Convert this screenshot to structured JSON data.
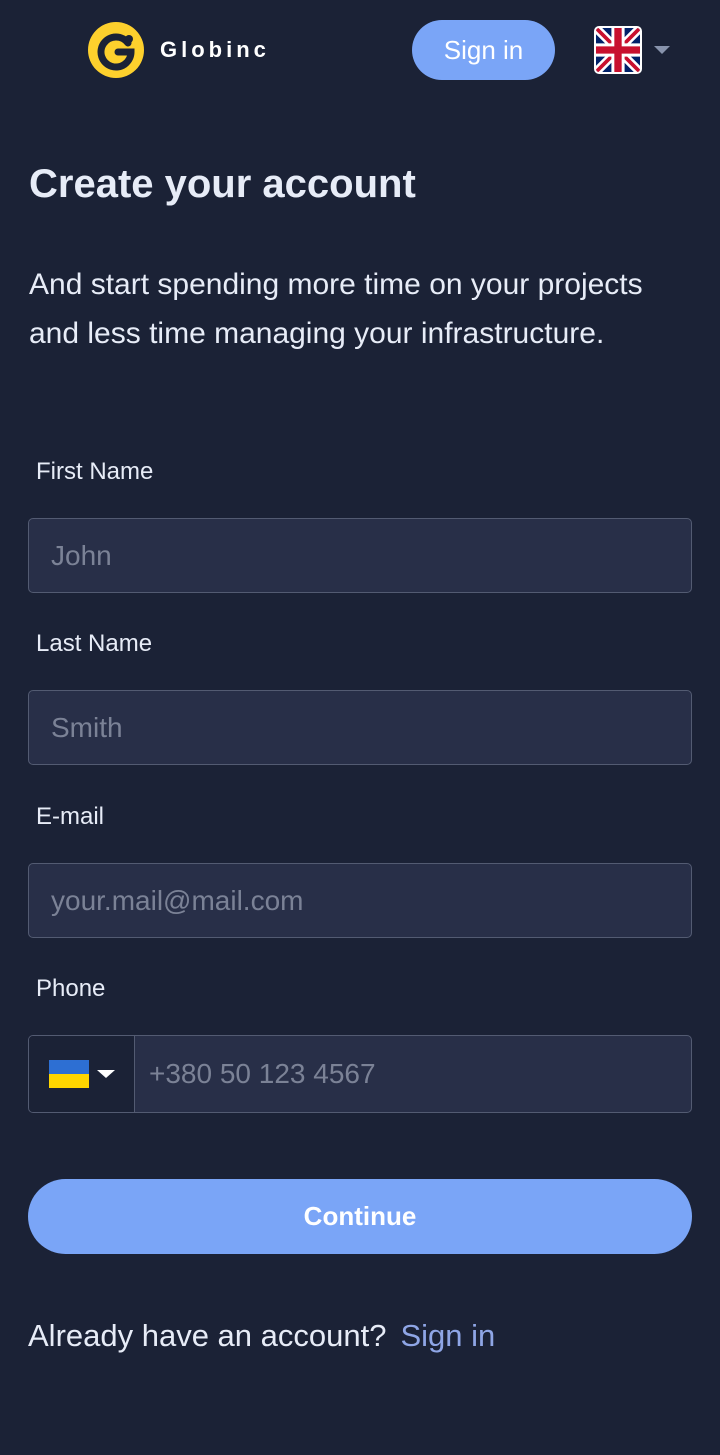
{
  "header": {
    "logo_text": "Globinc",
    "signin_label": "Sign in",
    "language": "English (UK)"
  },
  "main": {
    "title": "Create your account",
    "subtitle": "And start spending more time on your projects and less time managing your infrastructure."
  },
  "form": {
    "first_name": {
      "label": "First Name",
      "placeholder": "John",
      "value": ""
    },
    "last_name": {
      "label": "Last Name",
      "placeholder": "Smith",
      "value": ""
    },
    "email": {
      "label": "E-mail",
      "placeholder": "your.mail@mail.com",
      "value": ""
    },
    "phone": {
      "label": "Phone",
      "placeholder": "+380 50 123 4567",
      "value": "",
      "country": "UA"
    },
    "continue_label": "Continue"
  },
  "footer": {
    "prompt": "Already have an account?",
    "signin_link": "Sign in"
  },
  "colors": {
    "background": "#1b2236",
    "accent": "#7aa5f7",
    "logo_yellow": "#fdd02d",
    "link": "#8fa6e6"
  },
  "icons": {
    "logo": "globinc-logo-icon",
    "language": "uk-flag-icon",
    "phone_country": "ukraine-flag-icon"
  }
}
